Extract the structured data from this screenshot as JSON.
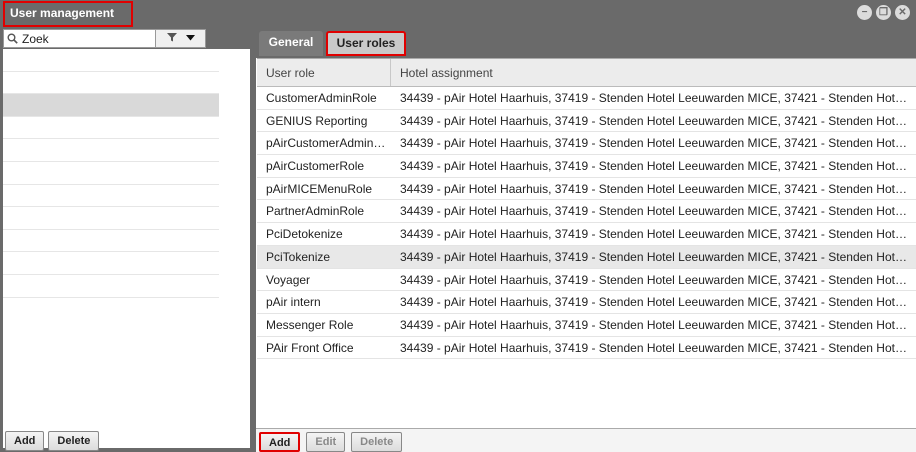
{
  "window": {
    "title": "User management",
    "controls": [
      "minimize-icon",
      "maximize-icon",
      "close-icon"
    ]
  },
  "left_panel": {
    "search": {
      "value": "Zoek",
      "placeholder": ""
    },
    "selected_index": 2,
    "row_count": 11,
    "buttons": {
      "add": "Add",
      "delete": "Delete"
    }
  },
  "tabs": [
    {
      "label": "General",
      "active": false
    },
    {
      "label": "User roles",
      "active": true
    }
  ],
  "grid": {
    "columns": [
      "User role",
      "Hotel assignment"
    ],
    "selected_index": 7,
    "rows": [
      {
        "role": "CustomerAdminRole",
        "hotels": "34439 - pAir Hotel Haarhuis, 37419 - Stenden Hotel Leeuwarden MICE, 37421 - Stenden Hotel…"
      },
      {
        "role": "GENIUS Reporting",
        "hotels": "34439 - pAir Hotel Haarhuis, 37419 - Stenden Hotel Leeuwarden MICE, 37421 - Stenden Hotel…"
      },
      {
        "role": "pAirCustomerAdmin…",
        "hotels": "34439 - pAir Hotel Haarhuis, 37419 - Stenden Hotel Leeuwarden MICE, 37421 - Stenden Hotel…"
      },
      {
        "role": "pAirCustomerRole",
        "hotels": "34439 - pAir Hotel Haarhuis, 37419 - Stenden Hotel Leeuwarden MICE, 37421 - Stenden Hotel…"
      },
      {
        "role": "pAirMICEMenuRole",
        "hotels": "34439 - pAir Hotel Haarhuis, 37419 - Stenden Hotel Leeuwarden MICE, 37421 - Stenden Hotel…"
      },
      {
        "role": "PartnerAdminRole",
        "hotels": "34439 - pAir Hotel Haarhuis, 37419 - Stenden Hotel Leeuwarden MICE, 37421 - Stenden Hotel…"
      },
      {
        "role": "PciDetokenize",
        "hotels": "34439 - pAir Hotel Haarhuis, 37419 - Stenden Hotel Leeuwarden MICE, 37421 - Stenden Hotel…"
      },
      {
        "role": "PciTokenize",
        "hotels": "34439 - pAir Hotel Haarhuis, 37419 - Stenden Hotel Leeuwarden MICE, 37421 - Stenden Hotel…"
      },
      {
        "role": "Voyager",
        "hotels": "34439 - pAir Hotel Haarhuis, 37419 - Stenden Hotel Leeuwarden MICE, 37421 - Stenden Hotel…"
      },
      {
        "role": "pAir intern",
        "hotels": "34439 - pAir Hotel Haarhuis, 37419 - Stenden Hotel Leeuwarden MICE, 37421 - Stenden Hotel…"
      },
      {
        "role": "Messenger Role",
        "hotels": "34439 - pAir Hotel Haarhuis, 37419 - Stenden Hotel Leeuwarden MICE, 37421 - Stenden Hotel…"
      },
      {
        "role": "PAir Front Office",
        "hotels": "34439 - pAir Hotel Haarhuis, 37419 - Stenden Hotel Leeuwarden MICE, 37421 - Stenden Hotel…"
      }
    ]
  },
  "right_footer": {
    "add": "Add",
    "edit": "Edit",
    "delete": "Delete"
  },
  "colors": {
    "chrome": "#6a6a6a",
    "highlight": "#e00000",
    "selected_row": "#e8e8e8"
  }
}
